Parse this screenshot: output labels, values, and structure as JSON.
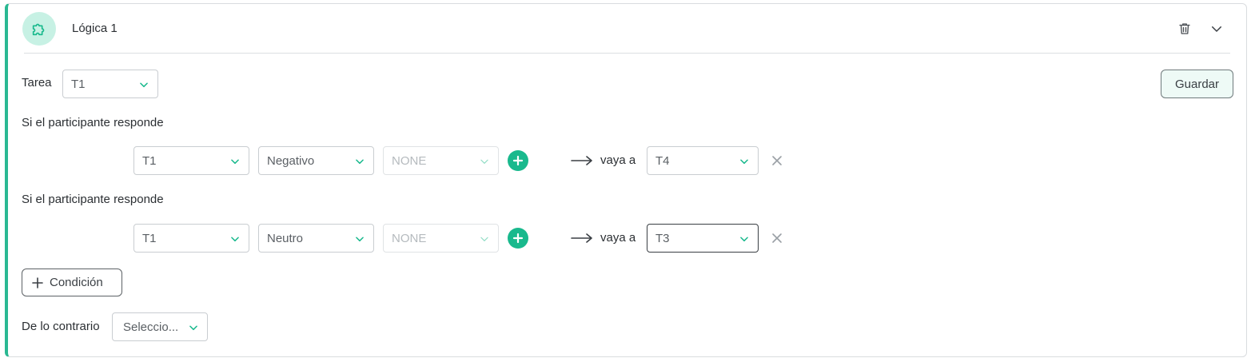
{
  "logic": {
    "title": "Lógica 1",
    "icon": "puzzle-icon"
  },
  "header_actions": {
    "delete_icon": "trash-icon",
    "collapse_icon": "chevron-down-icon"
  },
  "task": {
    "label": "Tarea",
    "selected": "T1"
  },
  "save_button": {
    "label": "Guardar"
  },
  "conditions": [
    {
      "label": "Si el participante responde",
      "question": "T1",
      "answer": "Negativo",
      "extra": "NONE",
      "goto_label": "vaya a",
      "target": "T4"
    },
    {
      "label": "Si el participante responde",
      "question": "T1",
      "answer": "Neutro",
      "extra": "NONE",
      "goto_label": "vaya a",
      "target": "T3"
    }
  ],
  "add_condition": {
    "label": "Condición"
  },
  "otherwise": {
    "label": "De lo contrario",
    "selected": "Seleccio..."
  },
  "colors": {
    "accent": "#2ab892",
    "accent_button": "#19b98d",
    "icon_bg": "#c7f1e4",
    "save_bg": "#eefaf6"
  }
}
